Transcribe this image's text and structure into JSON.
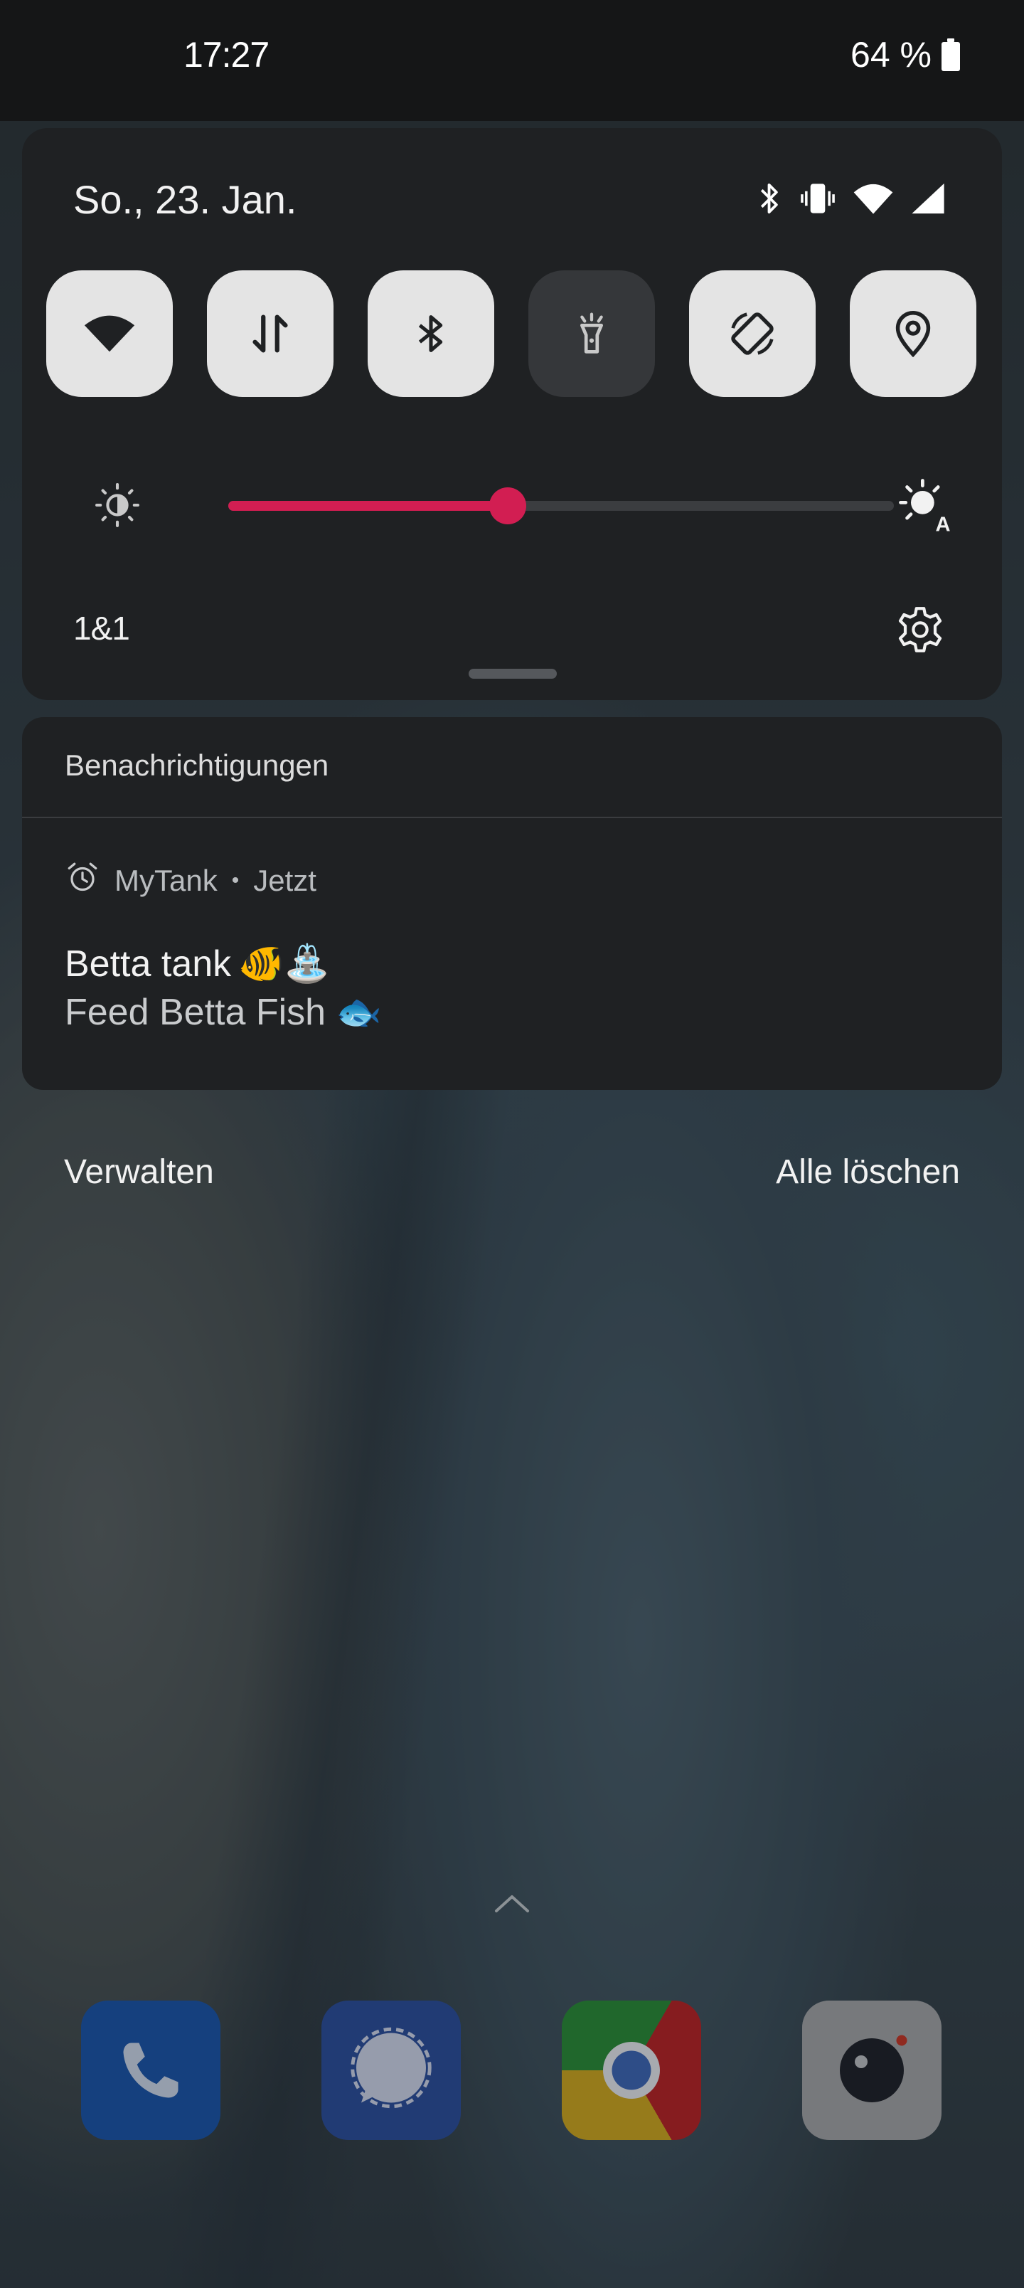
{
  "status_bar": {
    "time": "17:27",
    "battery": "64 %",
    "battery_icon": "battery-full-icon"
  },
  "quick_settings": {
    "date": "So., 23. Jan.",
    "status_icons": [
      "bluetooth-icon",
      "vibrate-icon",
      "wifi-icon",
      "cellular-signal-icon"
    ],
    "tiles": [
      {
        "name": "wifi",
        "icon": "wifi-icon",
        "active": true
      },
      {
        "name": "mobile-data",
        "icon": "mobile-data-icon",
        "active": true
      },
      {
        "name": "bluetooth",
        "icon": "bluetooth-icon",
        "active": true
      },
      {
        "name": "flashlight",
        "icon": "flashlight-icon",
        "active": false
      },
      {
        "name": "auto-rotate",
        "icon": "auto-rotate-icon",
        "active": true
      },
      {
        "name": "location",
        "icon": "location-icon",
        "active": true
      }
    ],
    "brightness_level": 0.42,
    "accent_color": "#d21e52",
    "carrier": "1&1",
    "settings_icon": "gear-icon"
  },
  "notifications": {
    "header": "Benachrichtigungen",
    "items": [
      {
        "app": "MyTank",
        "separator": "•",
        "time": "Jetzt",
        "icon": "alarm-clock-icon",
        "title": "Betta tank",
        "title_emoji": "🐠⛲",
        "text": "Feed Betta Fish",
        "text_emoji": "🐟"
      }
    ]
  },
  "actions": {
    "manage": "Verwalten",
    "clear_all": "Alle löschen"
  },
  "dock": {
    "apps": [
      "phone-app-icon",
      "signal-app-icon",
      "chrome-app-icon",
      "camera-app-icon"
    ]
  }
}
